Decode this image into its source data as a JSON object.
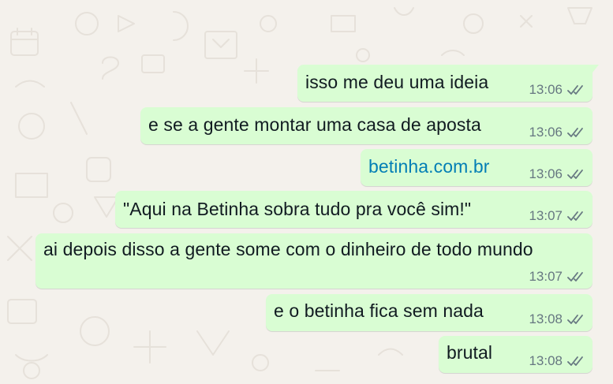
{
  "messages": [
    {
      "text": "isso me deu uma ideia",
      "time": "13:06",
      "status": "delivered-icon"
    },
    {
      "text": "e se a gente montar uma casa de aposta",
      "time": "13:06",
      "status": "delivered-icon"
    },
    {
      "text": "betinha.com.br",
      "time": "13:06",
      "status": "delivered-icon",
      "is_link": true
    },
    {
      "text": "\"Aqui na Betinha sobra tudo pra você sim!\"",
      "time": "13:07",
      "status": "delivered-icon"
    },
    {
      "text": "ai depois disso a gente some com o dinheiro de todo mundo",
      "time": "13:07",
      "status": "delivered-icon"
    },
    {
      "text": "e o betinha fica sem nada",
      "time": "13:08",
      "status": "delivered-icon"
    },
    {
      "text": "brutal",
      "time": "13:08",
      "status": "delivered-icon"
    }
  ],
  "colors": {
    "outgoing_bubble": "#d9fdd3",
    "background": "#f4f1ec",
    "link": "#027eb5",
    "meta": "#667781",
    "text": "#111b21"
  }
}
